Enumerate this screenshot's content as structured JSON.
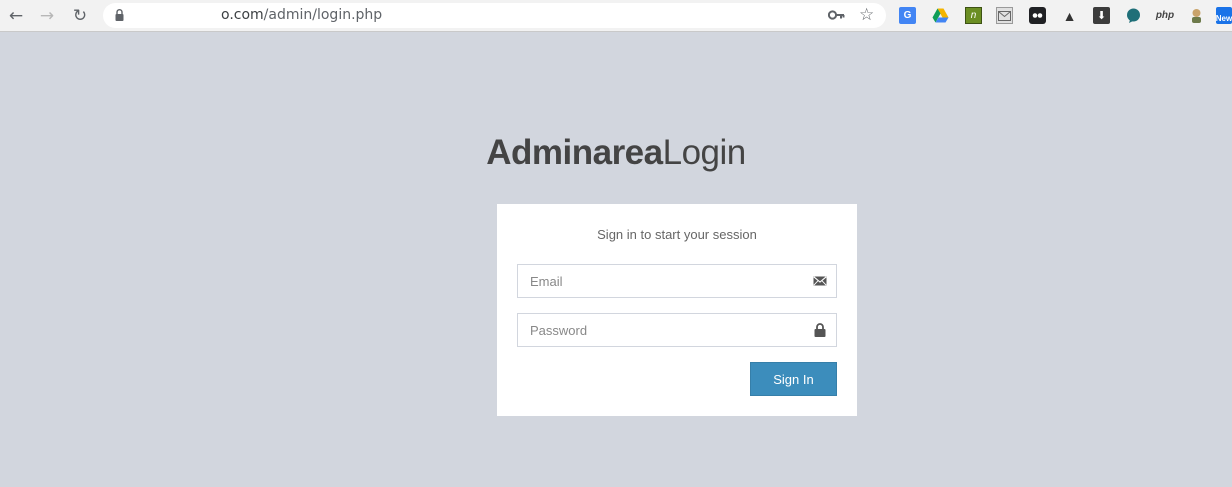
{
  "browser": {
    "url": {
      "host_visible": "o.com",
      "path": "/admin/login.php"
    },
    "extensions": {
      "translate": "G",
      "notes": "n",
      "download": "⬇",
      "php": "php",
      "news": "New"
    },
    "icons": [
      "back-icon",
      "forward-icon",
      "reload-icon",
      "lock-icon",
      "key-icon",
      "star-icon"
    ]
  },
  "login": {
    "logo_bold": "Adminarea",
    "logo_light": "Login",
    "message": "Sign in to start your session",
    "email": {
      "value": "",
      "placeholder": "Email"
    },
    "password": {
      "value": "",
      "placeholder": "Password"
    },
    "submit_label": "Sign In"
  },
  "colors": {
    "page_background": "#d2d6de",
    "button_primary": "#3c8dbc",
    "logo_text": "#444444"
  }
}
